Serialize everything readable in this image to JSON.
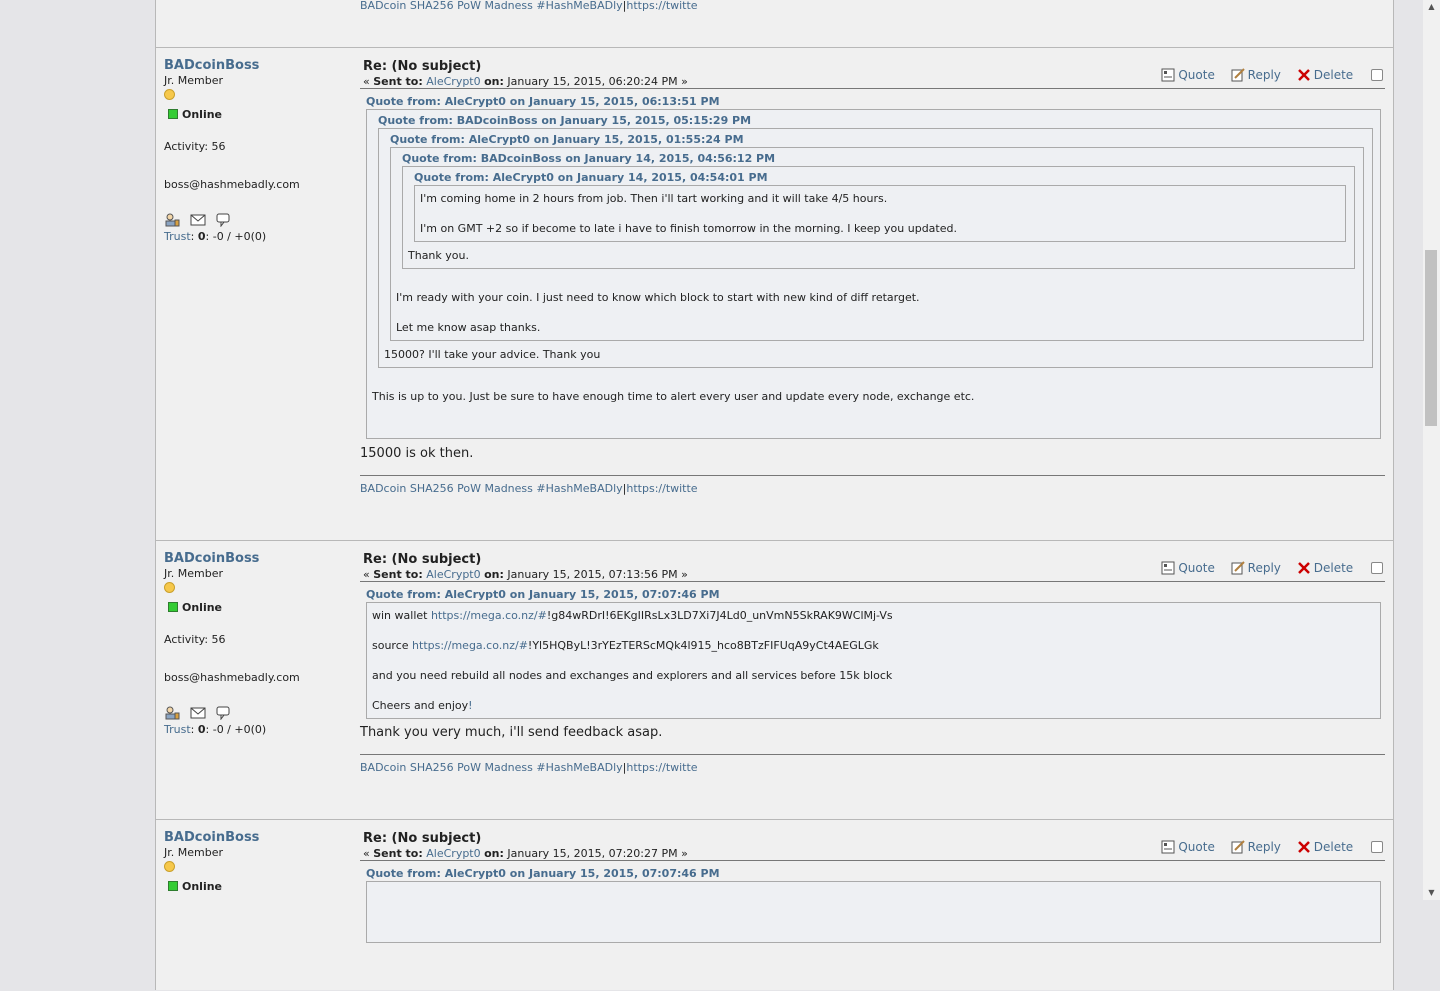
{
  "signature": {
    "part1": "BADcoin SHA256 PoW Madness #HashMeBADly",
    "separator": "|",
    "part2": "https://twitte"
  },
  "poster": {
    "name": "BADcoinBoss",
    "rank": "Jr. Member",
    "online": "Online",
    "activity": "Activity: 56",
    "email": "boss@hashmebadly.com",
    "trust_label": "Trust",
    "trust_colon": ":",
    "trust_score": "0",
    "trust_rest": ": -0 / +0(0)"
  },
  "common": {
    "title": "Re: (No subject)",
    "sent_prefix": "« ",
    "sent_to_label": "Sent to:",
    "sent_to_user": "AleCrypt0",
    "on_label": "on:",
    "sent_suffix": " »",
    "quote_label": "Quote",
    "reply_label": "Reply",
    "delete_label": "Delete"
  },
  "post1": {
    "date": "January 15, 2015, 06:20:24 PM",
    "q1_head": "Quote from: AleCrypt0 on January 15, 2015, 06:13:51 PM",
    "q2_head": "Quote from: BADcoinBoss on January 15, 2015, 05:15:29 PM",
    "q3_head": "Quote from: AleCrypt0 on January 15, 2015, 01:55:24 PM",
    "q4_head": "Quote from: BADcoinBoss on January 14, 2015, 04:56:12 PM",
    "q5_head": "Quote from: AleCrypt0 on January 14, 2015, 04:54:01 PM",
    "q5_line1": "I'm coming home in 2 hours from job. Then i'll tart working and it will take 4/5 hours.",
    "q5_line2": "I'm on GMT +2 so if become to late i have to finish tomorrow in the morning. I keep you updated.",
    "q4_text": "Thank you.",
    "q3_line1": "I'm ready with your coin. I just need to know which block to start with new kind of diff retarget.",
    "q3_line2": "Let me know asap thanks.",
    "q2_text": "15000? I'll take your advice. Thank you",
    "q1_text": "This is up to you. Just be sure to have enough time to alert every user and update every node, exchange etc.",
    "body": "15000 is ok then."
  },
  "post2": {
    "date": "January 15, 2015, 07:13:56 PM",
    "q_head": "Quote from: AleCrypt0 on January 15, 2015, 07:07:46 PM",
    "line1_prefix": "win wallet ",
    "line1_link": "https://mega.co.nz/#",
    "line1_rest": "!g84wRDrI!6EKgIIRsLx3LD7Xi7J4Ld0_unVmN5SkRAK9WClMj-Vs",
    "line2_prefix": "source ",
    "line2_link": "https://mega.co.nz/#",
    "line2_rest": "!Yl5HQByL!3rYEzTERScMQk4l915_hco8BTzFIFUqA9yCt4AEGLGk",
    "line3": "and you need rebuild all nodes and exchanges and explorers and all services before 15k block",
    "line4_prefix": "Cheers and enjoy",
    "line4_link": "!",
    "body": "Thank you very much, i'll send feedback asap."
  },
  "post3": {
    "date": "January 15, 2015, 07:20:27 PM",
    "q_head": "Quote from: AleCrypt0 on January 15, 2015, 07:07:46 PM"
  },
  "colors": {
    "link": "#476c8e",
    "page_bg": "#f0f0f0",
    "outer_bg": "#e5e5e8",
    "online_green": "#33cc33",
    "delete_red": "#cc0000",
    "star_yellow": "#f6c84b"
  },
  "icons": {
    "quote": "quote-icon",
    "reply": "reply-icon",
    "delete": "delete-icon",
    "profile": "profile-icon",
    "email": "email-icon",
    "message": "message-icon"
  }
}
